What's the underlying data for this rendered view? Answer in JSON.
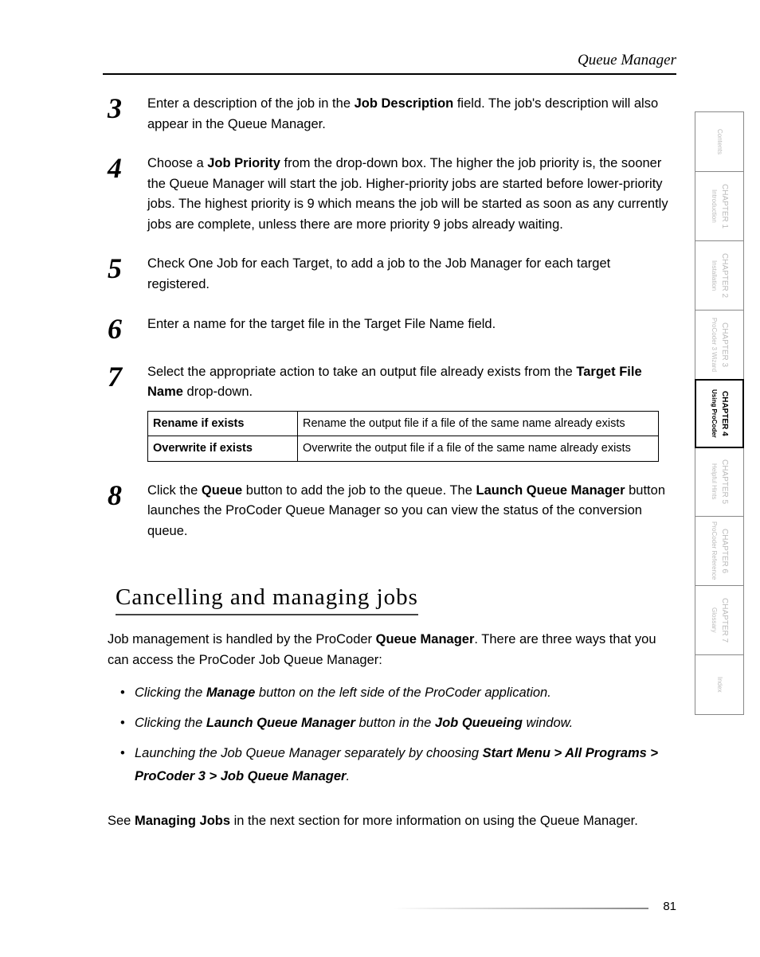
{
  "header": {
    "title": "Queue Manager"
  },
  "steps": [
    {
      "num": "3",
      "parts": [
        {
          "t": "Enter a description of the job in the "
        },
        {
          "t": "Job Description",
          "b": true
        },
        {
          "t": " field. The job's description will also appear in the Queue Manager."
        }
      ]
    },
    {
      "num": "4",
      "parts": [
        {
          "t": "Choose a "
        },
        {
          "t": "Job Priority",
          "b": true
        },
        {
          "t": " from the drop-down box. The higher the job priority is, the sooner the Queue Manager will start the job. Higher-priority jobs are started before lower-priority jobs. The highest priority is 9 which means the job will be started as soon as any currently jobs are complete, unless there are more priority 9 jobs already waiting."
        }
      ]
    },
    {
      "num": "5",
      "parts": [
        {
          "t": "Check One Job for each Target, to add a job to the Job Manager for each target registered."
        }
      ]
    },
    {
      "num": "6",
      "parts": [
        {
          "t": "Enter a name for the target file in the Target File Name field."
        }
      ]
    },
    {
      "num": "7",
      "parts": [
        {
          "t": "Select the appropriate action to take an output file already exists from the "
        },
        {
          "t": "Target File Name",
          "b": true
        },
        {
          "t": " drop-down."
        }
      ],
      "table": [
        {
          "h": "Rename if exists",
          "d": "Rename the output file if a file of the same name already exists"
        },
        {
          "h": "Overwrite if exists",
          "d": "Overwrite the output file if a file of the same name already exists"
        }
      ]
    },
    {
      "num": "8",
      "parts": [
        {
          "t": "Click the "
        },
        {
          "t": "Queue",
          "b": true
        },
        {
          "t": " button to add the job to the queue. The "
        },
        {
          "t": "Launch Queue Manager",
          "b": true
        },
        {
          "t": " button launches the ProCoder Queue Manager so you can view the status of the conversion queue."
        }
      ]
    }
  ],
  "h2": "Cancelling and managing jobs",
  "intro": [
    {
      "t": "Job management is handled by the ProCoder "
    },
    {
      "t": "Queue Manager",
      "b": true
    },
    {
      "t": ". There are three ways that you can access the ProCoder Job Queue Manager:"
    }
  ],
  "bullets": [
    [
      {
        "t": "Clicking the ",
        "i": true
      },
      {
        "t": "Manage",
        "b": true,
        "i": true
      },
      {
        "t": " button on the left side of the ProCoder application.",
        "i": true
      }
    ],
    [
      {
        "t": "Clicking the ",
        "i": true
      },
      {
        "t": "Launch Queue Manager",
        "b": true,
        "i": true
      },
      {
        "t": " button in the ",
        "i": true
      },
      {
        "t": "Job Queueing",
        "b": true,
        "i": true
      },
      {
        "t": " window.",
        "i": true
      }
    ],
    [
      {
        "t": "Launching the Job Queue Manager separately by choosing ",
        "i": true
      },
      {
        "t": "Start Menu > All Programs > ProCoder 3 > Job Queue Manager",
        "b": true,
        "i": true
      },
      {
        "t": ".",
        "i": true
      }
    ]
  ],
  "outro": [
    {
      "t": "See "
    },
    {
      "t": "Managing Jobs",
      "b": true
    },
    {
      "t": " in the next section for more information on using the Queue Manager."
    }
  ],
  "tabs": [
    {
      "chap": "",
      "sub": "Contents",
      "cls": "contents"
    },
    {
      "chap": "CHAPTER 1",
      "sub": "Introduction"
    },
    {
      "chap": "CHAPTER 2",
      "sub": "Installation"
    },
    {
      "chap": "CHAPTER 3",
      "sub": "ProCoder 3 Wizard"
    },
    {
      "chap": "CHAPTER 4",
      "sub": "Using ProCoder",
      "active": true
    },
    {
      "chap": "CHAPTER 5",
      "sub": "Helpful Hints"
    },
    {
      "chap": "CHAPTER 6",
      "sub": "ProCoder Reference"
    },
    {
      "chap": "CHAPTER 7",
      "sub": "Glossary"
    },
    {
      "chap": "",
      "sub": "Index",
      "cls": "contents"
    }
  ],
  "page": "81"
}
